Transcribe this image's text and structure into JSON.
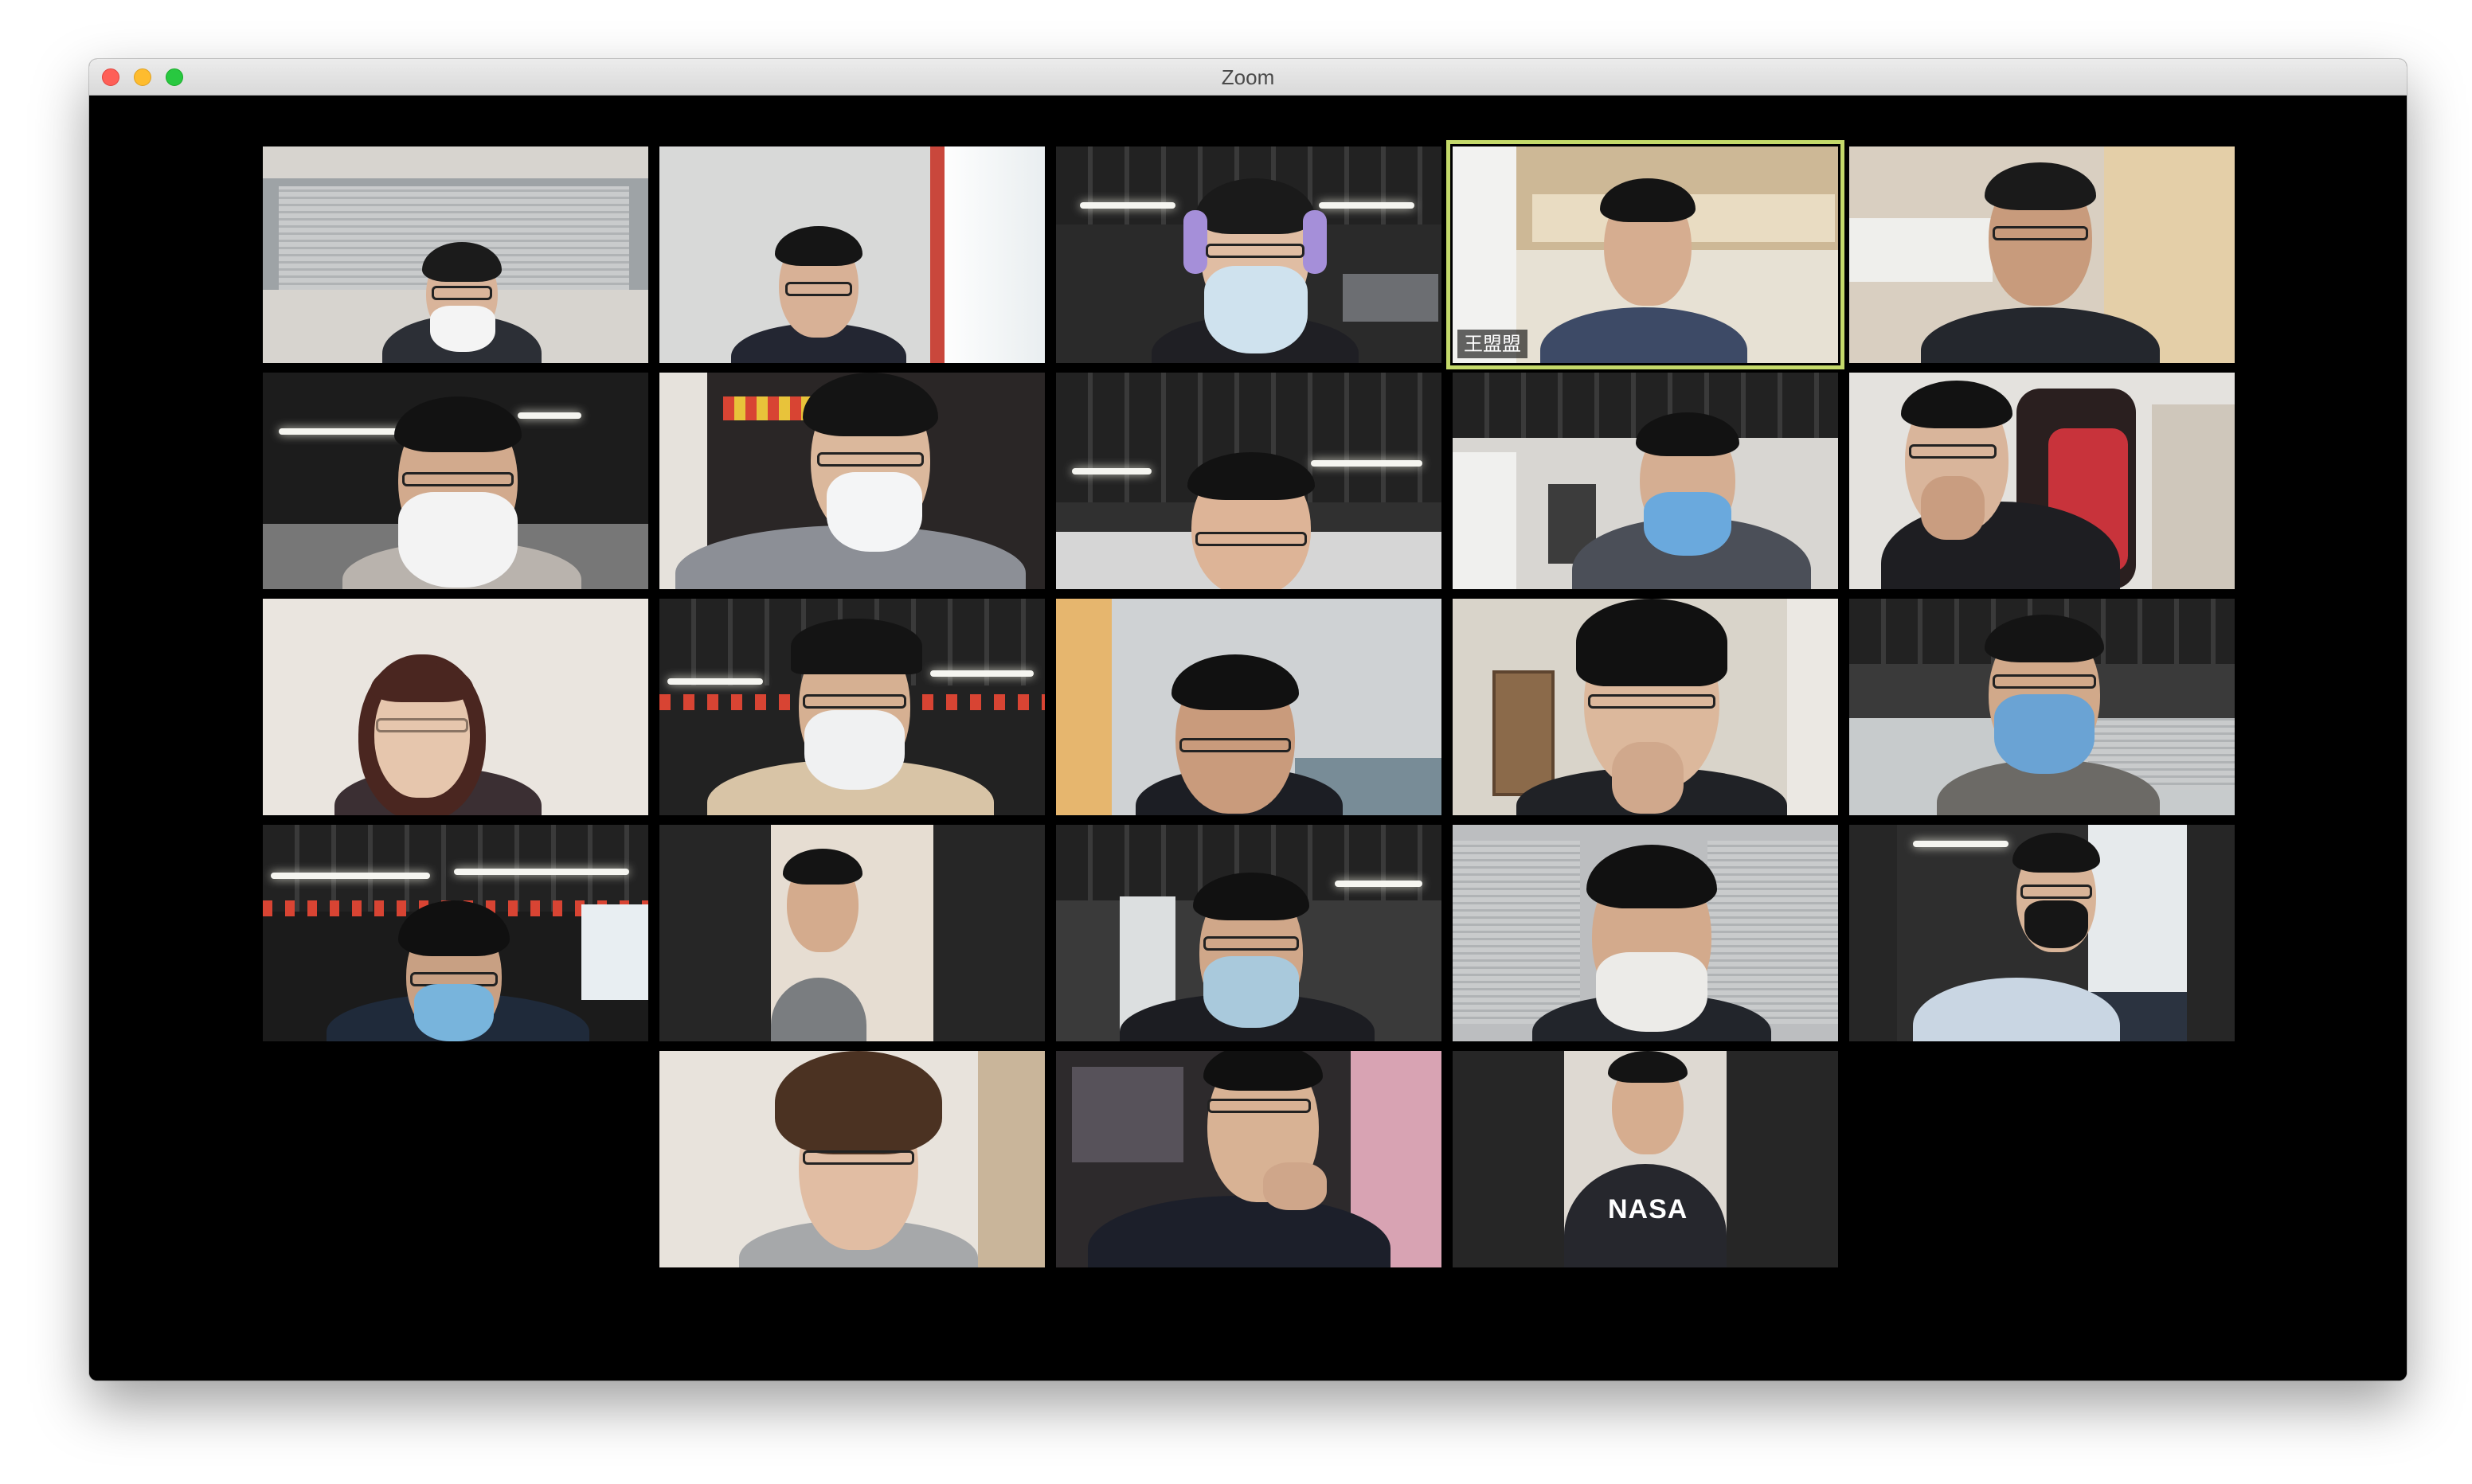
{
  "window": {
    "title": "Zoom"
  },
  "gallery": {
    "active_speaker_label": "王盟盟",
    "shirt_text": "NASA",
    "participant_count": 23
  },
  "colors": {
    "active_speaker_border": "#c4d96a",
    "stage_background": "#000000",
    "traffic_close": "#fe5f57",
    "traffic_minimize": "#febc2e",
    "traffic_maximize": "#28c840"
  },
  "icons": {
    "close": "close-icon",
    "minimize": "minimize-icon",
    "maximize": "maximize-icon"
  }
}
